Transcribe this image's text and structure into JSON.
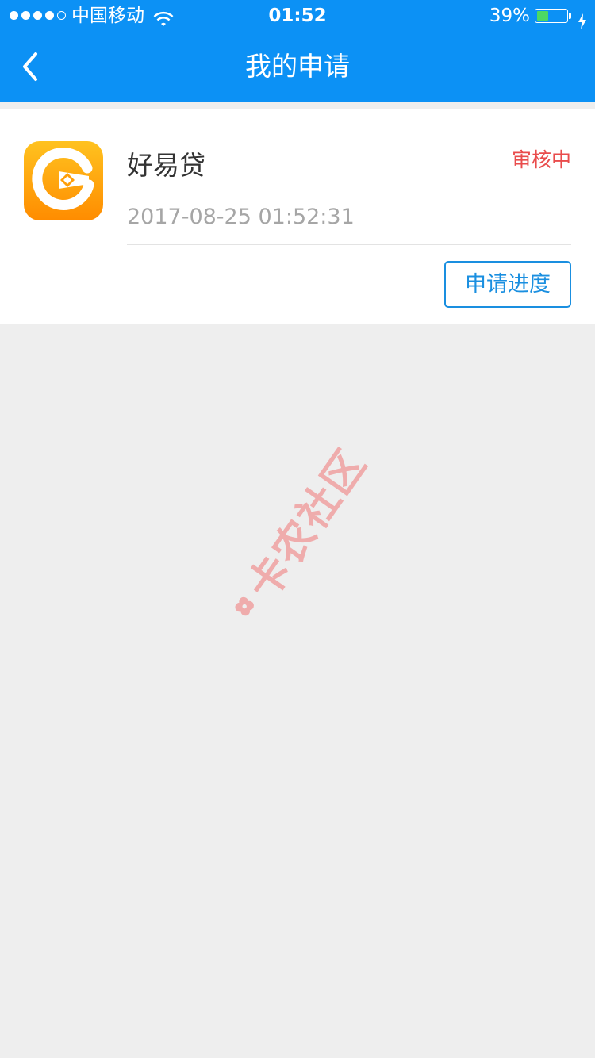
{
  "status_bar": {
    "carrier": "中国移动",
    "time": "01:52",
    "battery_percent": "39%",
    "battery_level": 0.39,
    "signal_bars_filled": 4,
    "signal_bars_total": 5
  },
  "nav": {
    "title": "我的申请",
    "back_icon": "chevron-left-icon"
  },
  "application": {
    "app_name": "好易贷",
    "status": "审核中",
    "submitted_at": "2017-08-25 01:52:31",
    "progress_button": "申请进度",
    "app_icon": "haoyidai-logo-icon"
  },
  "watermark": {
    "text": "卡农社区"
  },
  "colors": {
    "header_blue": "#0c91f5",
    "status_red": "#e94c4c",
    "button_blue": "#1a8fe0",
    "background_gray": "#eeeeee",
    "watermark_pink": "#f0a9a9"
  }
}
